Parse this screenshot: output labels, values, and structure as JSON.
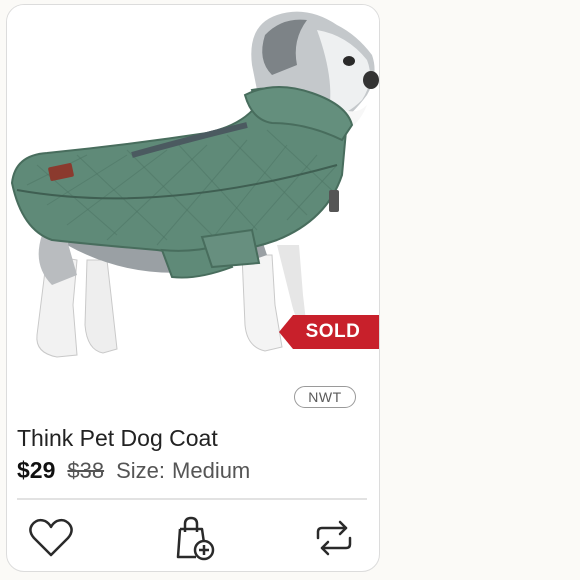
{
  "listing": {
    "sold_label": "SOLD",
    "condition_badge": "NWT",
    "title": "Think Pet Dog Coat",
    "price": "$29",
    "original_price": "$38",
    "size_label": "Size:",
    "size_value": "Medium"
  },
  "actions": {
    "like_icon": "heart-outline-icon",
    "bundle_icon": "shopping-bag-plus-icon",
    "share_icon": "repeat-arrows-icon"
  },
  "colors": {
    "sold_banner": "#c8202b",
    "coat_green": "#5f8a78"
  }
}
